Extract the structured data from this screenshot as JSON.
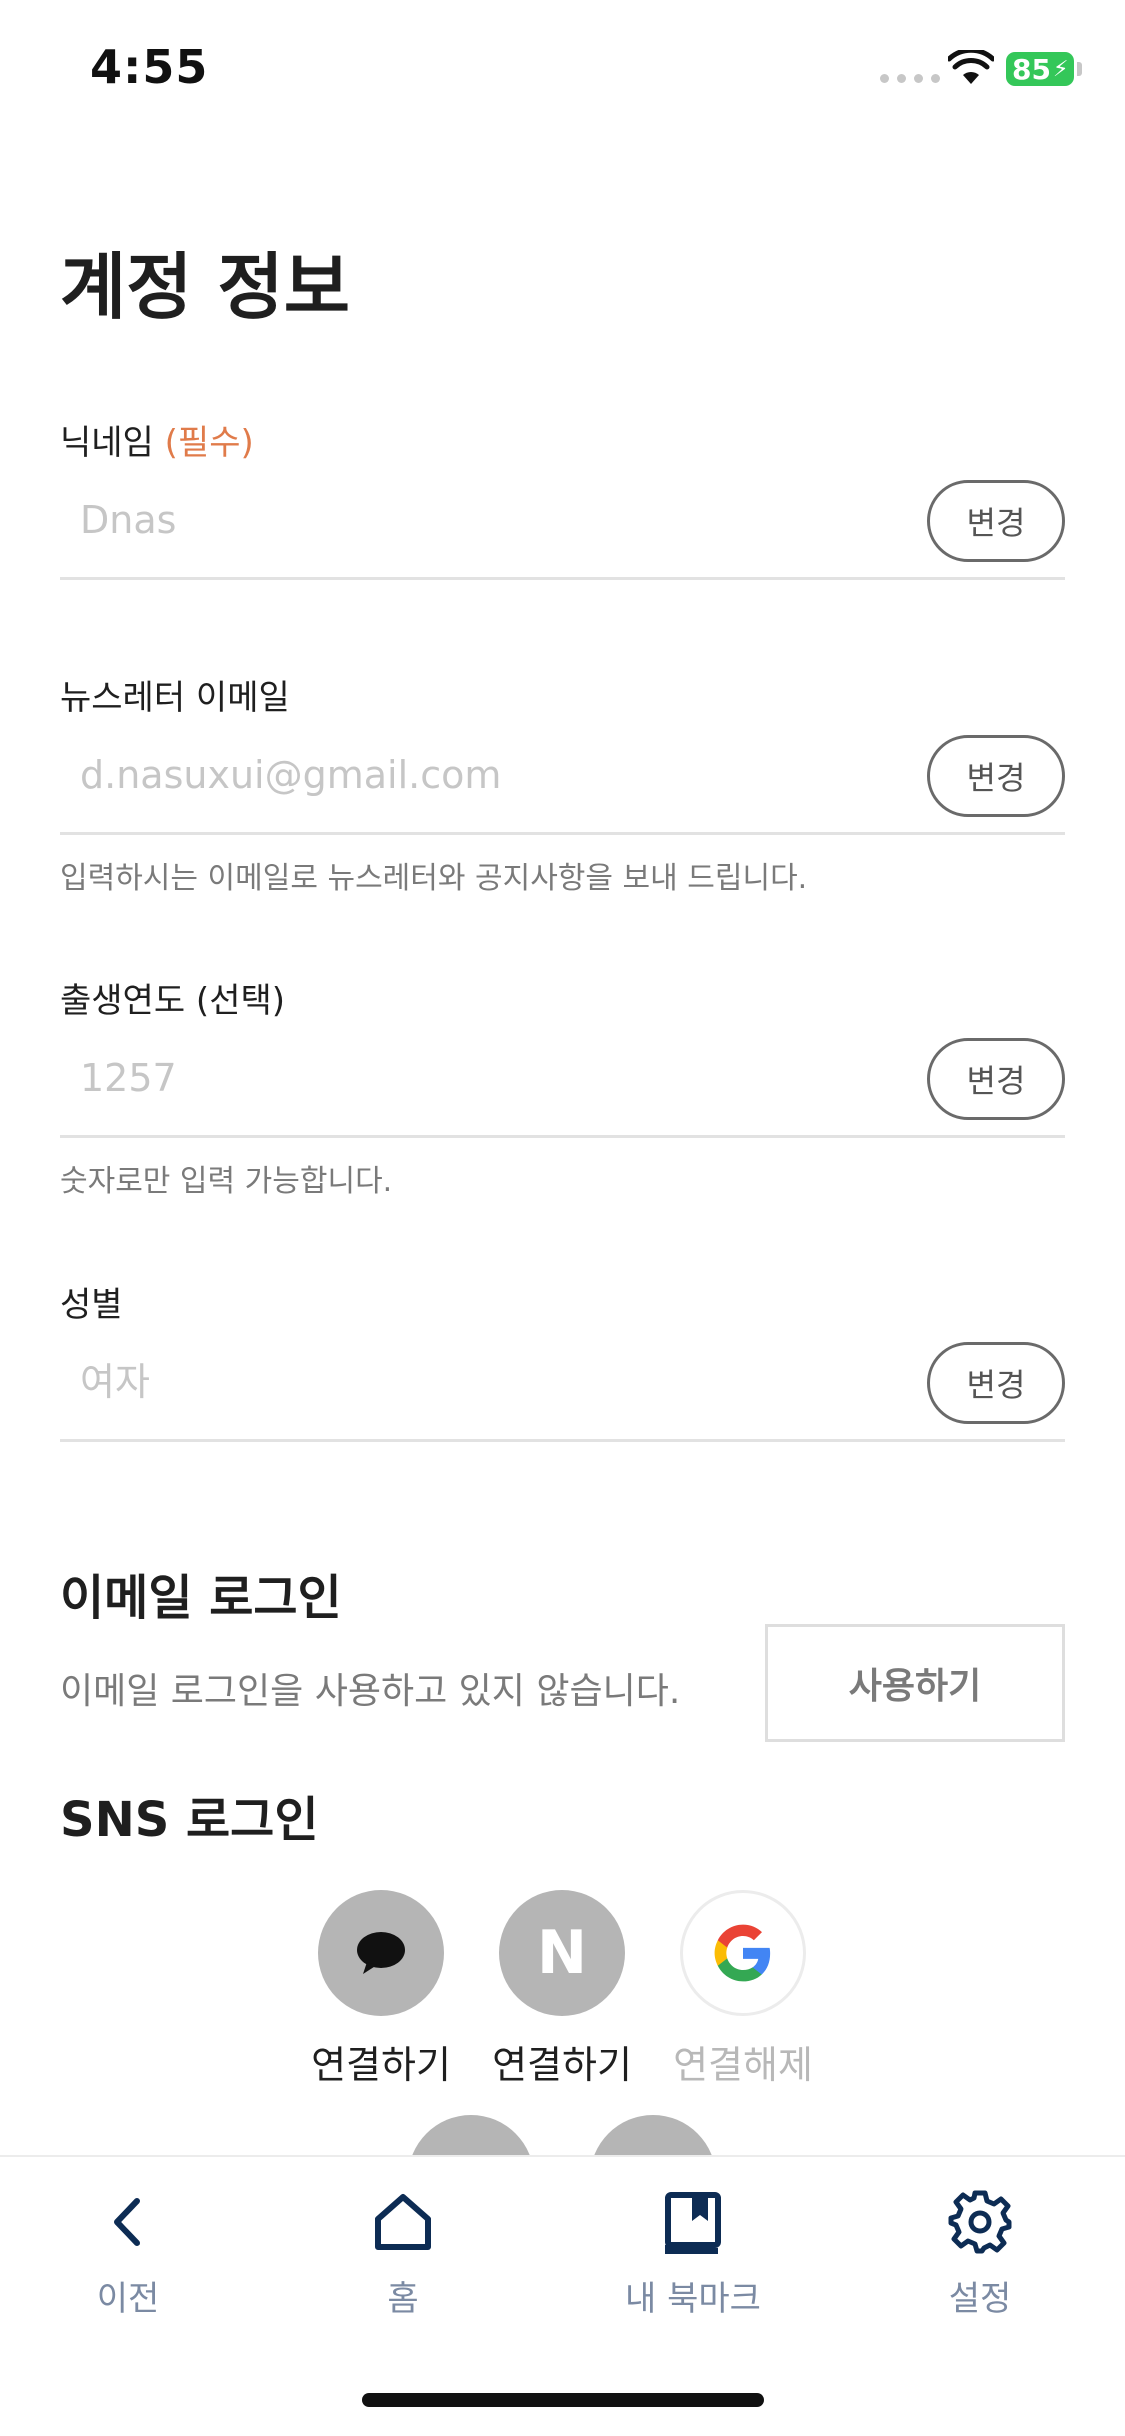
{
  "status_bar": {
    "time": "4:55",
    "battery": "85"
  },
  "page": {
    "title": "계정 정보"
  },
  "fields": {
    "nickname": {
      "label": "닉네임",
      "required": "(필수)",
      "placeholder": "Dnas",
      "button": "변경"
    },
    "newsletter_email": {
      "label": "뉴스레터 이메일",
      "placeholder": "d.nasuxui@gmail.com",
      "button": "변경",
      "help": "입력하시는 이메일로 뉴스레터와 공지사항을 보내 드립니다."
    },
    "birth_year": {
      "label": "출생연도 (선택)",
      "placeholder": "1257",
      "button": "변경",
      "help": "숫자로만 입력 가능합니다."
    },
    "gender": {
      "label": "성별",
      "placeholder": "여자",
      "button": "변경"
    }
  },
  "email_login": {
    "title": "이메일 로그인",
    "description": "이메일 로그인을 사용하고 있지 않습니다.",
    "button": "사용하기"
  },
  "sns_login": {
    "title": "SNS 로그인",
    "providers": [
      {
        "icon": "kakao-chat-icon",
        "label": "연결하기"
      },
      {
        "icon": "naver-icon",
        "glyph": "N",
        "label": "연결하기"
      },
      {
        "icon": "google-icon",
        "glyph": "G",
        "label": "연결해제"
      }
    ]
  },
  "bottom_nav": {
    "items": [
      {
        "icon": "back-chevron-icon",
        "label": "이전"
      },
      {
        "icon": "home-icon",
        "label": "홈"
      },
      {
        "icon": "bookmark-icon",
        "label": "내 북마크"
      },
      {
        "icon": "gear-icon",
        "label": "설정"
      }
    ]
  },
  "colors": {
    "accent": "#e07b4a",
    "nav_icon": "#0d2c54",
    "nav_label": "#7b8aa3",
    "battery": "#34c759",
    "sns_gray": "#b5b5b5"
  }
}
